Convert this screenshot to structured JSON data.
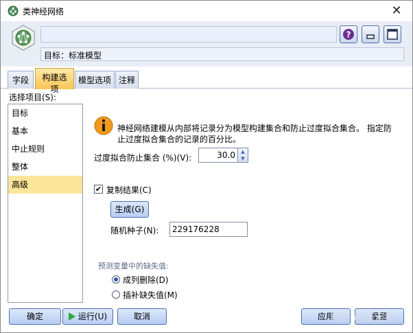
{
  "window": {
    "title": "类神经网络",
    "close_glyph": "✕"
  },
  "header": {
    "target": "目标：标准模型"
  },
  "tabs": [
    {
      "label": "字段",
      "active": false
    },
    {
      "label": "构建选项",
      "active": true
    },
    {
      "label": "模型选项",
      "active": false
    },
    {
      "label": "注释",
      "active": false
    }
  ],
  "panel": {
    "select_label": "选择项目(S):",
    "items": [
      {
        "label": "目标",
        "selected": false
      },
      {
        "label": "基本",
        "selected": false
      },
      {
        "label": "中止规则",
        "selected": false
      },
      {
        "label": "整体",
        "selected": false
      },
      {
        "label": "高级",
        "selected": true
      }
    ]
  },
  "advanced": {
    "info_text": "神经网络建模从内部将记录分为模型构建集合和防止过度拟合集合。 指定防止过度拟合集合的记录的百分比。",
    "overfit_label": "过度拟合防止集合 (%)(V):",
    "overfit_value": "30.0",
    "copy_results_label": "复制结果(C)",
    "copy_results_checked": true,
    "generate_label": "生成(G)",
    "seed_label": "随机种子(N):",
    "seed_value": "229176228",
    "missing_label": "预测变量中的缺失值:",
    "missing_options": [
      {
        "label": "成列删除(D)",
        "checked": true
      },
      {
        "label": "插补缺失值(M)",
        "checked": false
      }
    ]
  },
  "footer": {
    "ok": "确定",
    "run": "运行(U)",
    "cancel": "取消",
    "apply": "应用",
    "reset": "重置"
  },
  "watermark": "知乎 @张宏彬",
  "colors": {
    "accent": "#4c6fae",
    "active_tab": "#f8c554",
    "selection": "#fbe59a"
  }
}
